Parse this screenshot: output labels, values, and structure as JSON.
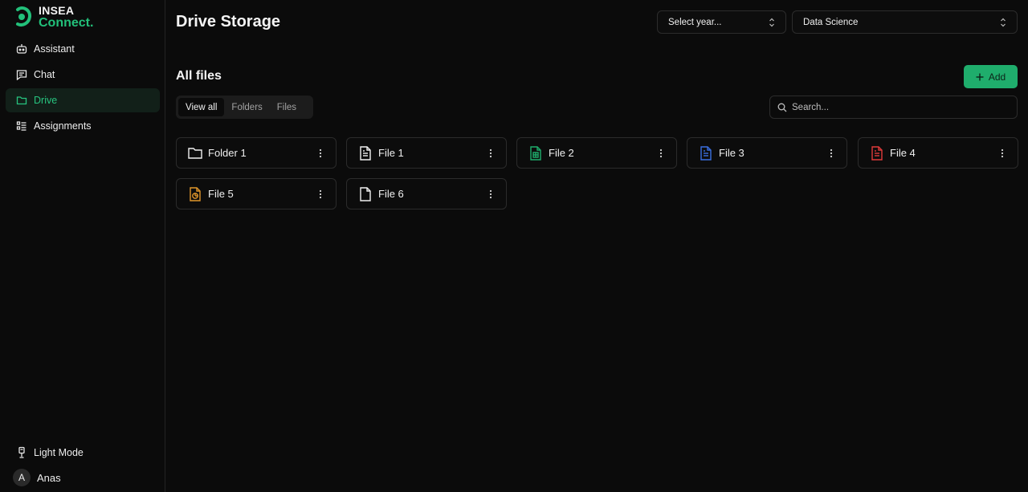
{
  "brand": {
    "line1": "INSEA",
    "line2": "Connect.",
    "accent": "#22c07a"
  },
  "nav": [
    {
      "label": "Assistant",
      "icon": "bot-icon"
    },
    {
      "label": "Chat",
      "icon": "chat-icon"
    },
    {
      "label": "Drive",
      "icon": "folder-icon",
      "active": true
    },
    {
      "label": "Assignments",
      "icon": "list-check-icon"
    }
  ],
  "sidebar_bottom": {
    "light_mode_label": "Light Mode",
    "user_initial": "A",
    "user_name": "Anas"
  },
  "header": {
    "title": "Drive Storage",
    "year_select": "Select year...",
    "subject_select": "Data Science"
  },
  "files_section": {
    "title": "All files",
    "add_label": "Add",
    "tabs": [
      "View all",
      "Folders",
      "Files"
    ],
    "active_tab": "View all",
    "search_placeholder": "Search..."
  },
  "items": [
    {
      "label": "Folder 1",
      "icon": "folder-icon",
      "color": "#f0f0f0"
    },
    {
      "label": "File 1",
      "icon": "document-icon",
      "color": "#f0f0f0"
    },
    {
      "label": "File 2",
      "icon": "spreadsheet-icon",
      "color": "#1fad6c"
    },
    {
      "label": "File 3",
      "icon": "word-document-icon",
      "color": "#3b6fe0"
    },
    {
      "label": "File 4",
      "icon": "pdf-document-icon",
      "color": "#e03b3b"
    },
    {
      "label": "File 5",
      "icon": "presentation-file-icon",
      "color": "#e0962b"
    },
    {
      "label": "File 6",
      "icon": "blank-file-icon",
      "color": "#f0f0f0"
    }
  ]
}
